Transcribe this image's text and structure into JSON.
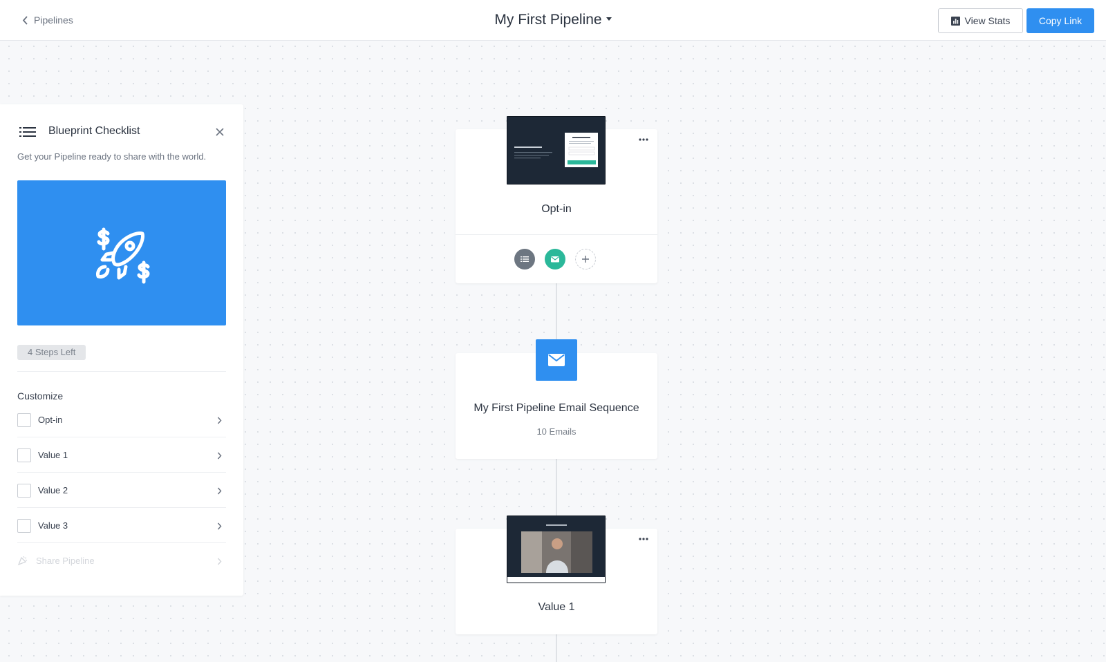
{
  "header": {
    "back_label": "Pipelines",
    "title": "My First Pipeline",
    "view_stats_label": "View Stats",
    "copy_link_label": "Copy Link"
  },
  "checklist": {
    "title": "Blueprint Checklist",
    "subtitle": "Get your Pipeline ready to share with the world.",
    "steps_left": "4 Steps Left",
    "section_label": "Customize",
    "items": [
      {
        "label": "Opt-in",
        "checked": false
      },
      {
        "label": "Value 1",
        "checked": false
      },
      {
        "label": "Value 2",
        "checked": false
      },
      {
        "label": "Value 3",
        "checked": false
      }
    ],
    "share_label": "Share Pipeline"
  },
  "cards": {
    "optin": {
      "title": "Opt-in"
    },
    "email": {
      "title": "My First Pipeline Email Sequence",
      "subtitle": "10 Emails"
    },
    "value1": {
      "title": "Value 1"
    }
  },
  "colors": {
    "accent": "#2f8ff0",
    "email_green": "#2bb89a",
    "list_grey": "#6d7681"
  }
}
